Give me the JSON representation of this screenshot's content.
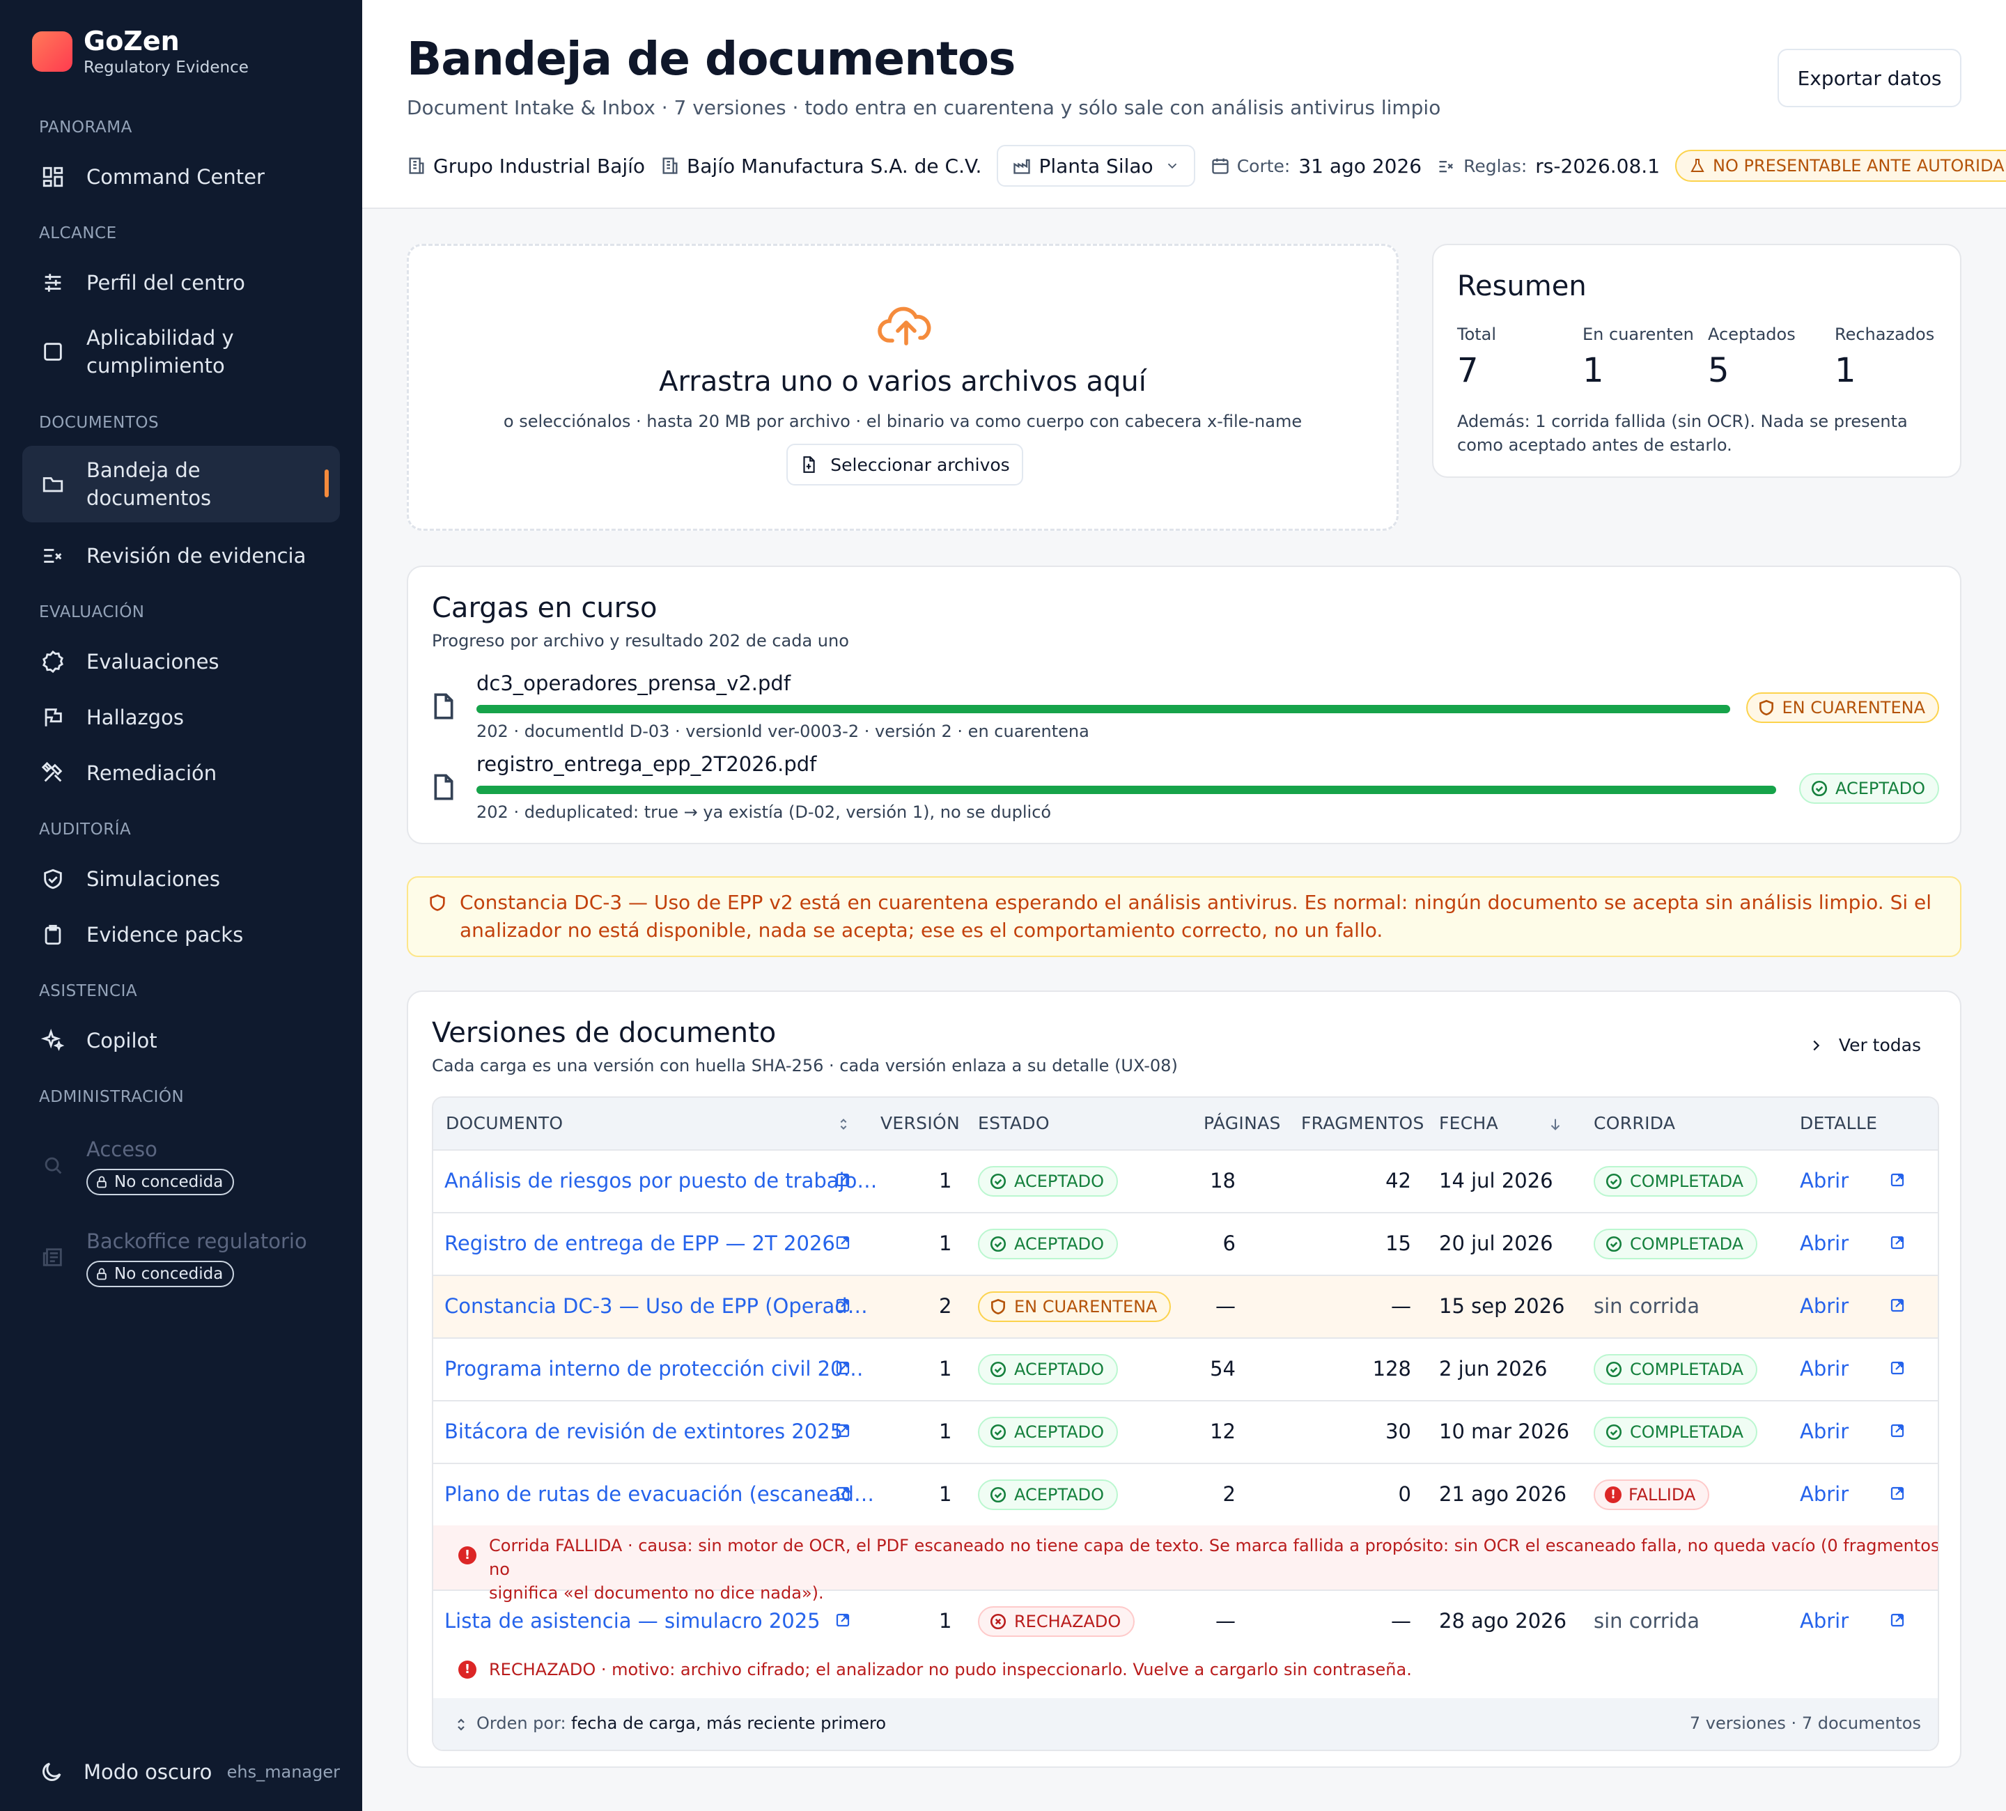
{
  "brand": {
    "name": "GoZen",
    "subtitle": "Regulatory Evidence"
  },
  "sidebar": {
    "sections": {
      "panorama": "PANORAMA",
      "alcance": "ALCANCE",
      "documentos": "DOCUMENTOS",
      "evaluacion": "EVALUACIÓN",
      "auditoria": "AUDITORÍA",
      "asistencia": "ASISTENCIA",
      "administracion": "ADMINISTRACIÓN"
    },
    "items": {
      "command_center": "Command Center",
      "perfil": "Perfil del centro",
      "aplicabilidad_1": "Aplicabilidad y",
      "aplicabilidad_2": "cumplimiento",
      "bandeja_1": "Bandeja de",
      "bandeja_2": "documentos",
      "revision": "Revisión de evidencia",
      "evaluaciones": "Evaluaciones",
      "hallazgos": "Hallazgos",
      "remediacion": "Remediación",
      "simulaciones": "Simulaciones",
      "evidence_packs": "Evidence packs",
      "copilot": "Copilot",
      "acceso": "Acceso",
      "backoffice": "Backoffice regulatorio"
    },
    "lock_label": "No concedida",
    "footer": {
      "mode": "Modo oscuro",
      "user": "ehs_manager"
    }
  },
  "header": {
    "title": "Bandeja de documentos",
    "subtitle": "Document Intake & Inbox · 7 versiones · todo entra en cuarentena y sólo sale con análisis antivirus limpio",
    "export_label": "Exportar datos",
    "group": "Grupo Industrial Bajío",
    "company": "Bajío Manufactura S.A. de C.V.",
    "plant": "Planta Silao",
    "cut_label": "Corte:",
    "cut_value": "31 ago 2026",
    "rules_label": "Reglas:",
    "rules_value": "rs-2026.08.1",
    "warning": "NO PRESENTABLE ANTE AUTORIDAD"
  },
  "dropzone": {
    "title": "Arrastra uno o varios archivos aquí",
    "subtitle": "o selecciónalos · hasta 20 MB por archivo · el binario va como cuerpo con cabecera x-file-name",
    "button": "Seleccionar archivos"
  },
  "summary": {
    "title": "Resumen",
    "stats": [
      {
        "label": "Total",
        "value": "7"
      },
      {
        "label": "En cuarenten",
        "value": "1"
      },
      {
        "label": "Aceptados",
        "value": "5"
      },
      {
        "label": "Rechazados",
        "value": "1"
      }
    ],
    "note": "Además: 1 corrida fallida (sin OCR). Nada se presenta como aceptado antes de estarlo."
  },
  "uploads": {
    "title": "Cargas en curso",
    "subtitle": "Progreso por archivo y resultado 202 de cada uno",
    "items": [
      {
        "name": "dc3_operadores_prensa_v2.pdf",
        "meta": "202 · documentId D-03 · versionId ver-0003-2 · versión 2 · en cuarentena",
        "status": "EN CUARENTENA",
        "progress": 100
      },
      {
        "name": "registro_entrega_epp_2T2026.pdf",
        "meta": "202 · deduplicated: true → ya existía (D-02, versión 1), no se duplicó",
        "status": "ACEPTADO",
        "progress": 100
      }
    ]
  },
  "alert": {
    "text": "Constancia DC-3 — Uso de EPP v2 está en cuarentena esperando el análisis antivirus. Es normal: ningún documento se acepta sin análisis limpio. Si el analizador no está disponible, nada se acepta; ese es el comportamiento correcto, no un fallo."
  },
  "versions": {
    "title": "Versiones de documento",
    "subtitle": "Cada carga es una versión con huella SHA-256 · cada versión enlaza a su detalle (UX-08)",
    "view_all": "Ver todas",
    "columns": {
      "documento": "DOCUMENTO",
      "version": "VERSIÓN",
      "estado": "ESTADO",
      "paginas": "PÁGINAS",
      "fragmentos": "FRAGMENTOS",
      "fecha": "FECHA",
      "corrida": "CORRIDA",
      "detalle": "DETALLE"
    },
    "rows": [
      {
        "doc": "Análisis de riesgos por puesto de trabajo…",
        "version": "1",
        "estado": "ACEPTADO",
        "paginas": "18",
        "fragmentos": "42",
        "fecha": "14 jul 2026",
        "corrida": "COMPLETADA",
        "detalle": "Abrir"
      },
      {
        "doc": "Registro de entrega de EPP — 2T 2026",
        "version": "1",
        "estado": "ACEPTADO",
        "paginas": "6",
        "fragmentos": "15",
        "fecha": "20 jul 2026",
        "corrida": "COMPLETADA",
        "detalle": "Abrir"
      },
      {
        "doc": "Constancia DC-3 — Uso de EPP (Operad…",
        "version": "2",
        "estado": "EN CUARENTENA",
        "paginas": "—",
        "fragmentos": "—",
        "fecha": "15 sep 2026",
        "corrida": "sin corrida",
        "detalle": "Abrir"
      },
      {
        "doc": "Programa interno de protección civil 20…",
        "version": "1",
        "estado": "ACEPTADO",
        "paginas": "54",
        "fragmentos": "128",
        "fecha": "2 jun 2026",
        "corrida": "COMPLETADA",
        "detalle": "Abrir"
      },
      {
        "doc": "Bitácora de revisión de extintores 2025",
        "version": "1",
        "estado": "ACEPTADO",
        "paginas": "12",
        "fragmentos": "30",
        "fecha": "10 mar 2026",
        "corrida": "COMPLETADA",
        "detalle": "Abrir"
      },
      {
        "doc": "Plano de rutas de evacuación (escanead…",
        "version": "1",
        "estado": "ACEPTADO",
        "paginas": "2",
        "fragmentos": "0",
        "fecha": "21 ago 2026",
        "corrida": "FALLIDA",
        "detalle": "Abrir"
      },
      {
        "doc": "Lista de asistencia — simulacro 2025",
        "version": "1",
        "estado": "RECHAZADO",
        "paginas": "—",
        "fragmentos": "—",
        "fecha": "28 ago 2026",
        "corrida": "sin corrida",
        "detalle": "Abrir"
      }
    ],
    "error_fallida_1": "Corrida FALLIDA · causa: sin motor de OCR, el PDF escaneado no tiene capa de texto. Se marca fallida a propósito: sin OCR el escaneado falla, no queda vacío (0 fragmentos no",
    "error_fallida_2": "significa «el documento no dice nada»).",
    "error_rechazado": "RECHAZADO · motivo: archivo cifrado; el analizador no pudo inspeccionarlo. Vuelve a cargarlo sin contraseña.",
    "sort_label": "Orden por:",
    "sort_value": "fecha de carga, más reciente primero",
    "count": "7 versiones · 7 documentos"
  }
}
